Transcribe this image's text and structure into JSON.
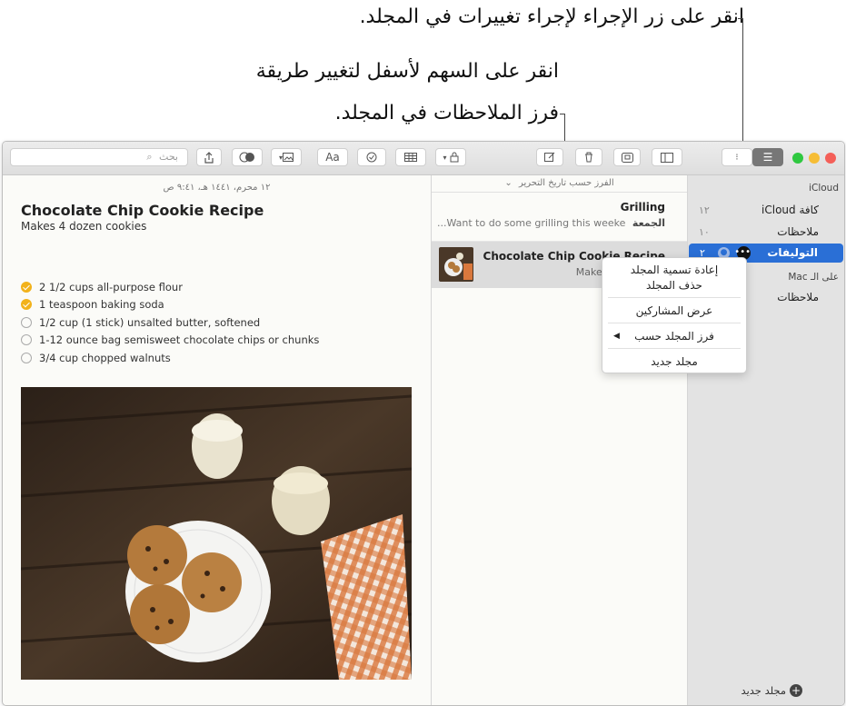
{
  "callouts": {
    "action_button": "انقر على زر الإجراء لإجراء تغييرات في المجلد.",
    "sort_arrow_line1": "انقر على السهم لأسفل لتغيير طريقة",
    "sort_arrow_line2": "فرز الملاحظات في المجلد."
  },
  "toolbar": {
    "search_placeholder": "بحث",
    "format_label": "Aa"
  },
  "editor": {
    "date": "١٢ محرم، ١٤٤١ هـ، ٩:٤١ ص",
    "title": "Chocolate Chip Cookie Recipe",
    "subtitle": "Makes 4 dozen cookies",
    "checklist": [
      {
        "text": "2 1/2 cups all-purpose flour",
        "done": true
      },
      {
        "text": "1 teaspoon baking soda",
        "done": true
      },
      {
        "text": "1/2 cup (1 stick) unsalted butter, softened",
        "done": false
      },
      {
        "text": "1-12 ounce bag semisweet chocolate chips or chunks",
        "done": false
      },
      {
        "text": "3/4 cup chopped walnuts",
        "done": false
      }
    ]
  },
  "note_list": {
    "sort_label": "الفرز حسب تاريخ التحرير",
    "items": [
      {
        "title": "Grilling",
        "day": "الجمعة",
        "preview": "Want to do some grilling this weeke..."
      },
      {
        "title": "Chocolate Chip Cookie Recipe",
        "preview": "Makes 4 dozen co"
      }
    ]
  },
  "sidebar": {
    "icloud_header": "iCloud",
    "items": [
      {
        "label": "كافة iCloud",
        "count": "١٢"
      },
      {
        "label": "ملاحظات",
        "count": "١٠"
      },
      {
        "label": "التوليفات",
        "count": "٢"
      }
    ],
    "mac_header": "على الـ Mac",
    "mac_items": [
      {
        "label": "ملاحظات"
      }
    ],
    "new_folder": "مجلد جديد"
  },
  "context_menu": {
    "rename": "إعادة تسمية المجلد",
    "delete": "حذف المجلد",
    "participants": "عرض المشاركين",
    "sort_by": "فرز المجلد حسب",
    "new_folder": "مجلد جديد"
  },
  "colors": {
    "accent": "#2a6fd6",
    "check_done": "#f2b21b",
    "close": "#f45f58",
    "minimize": "#f6bd35",
    "zoom": "#2fc840"
  }
}
